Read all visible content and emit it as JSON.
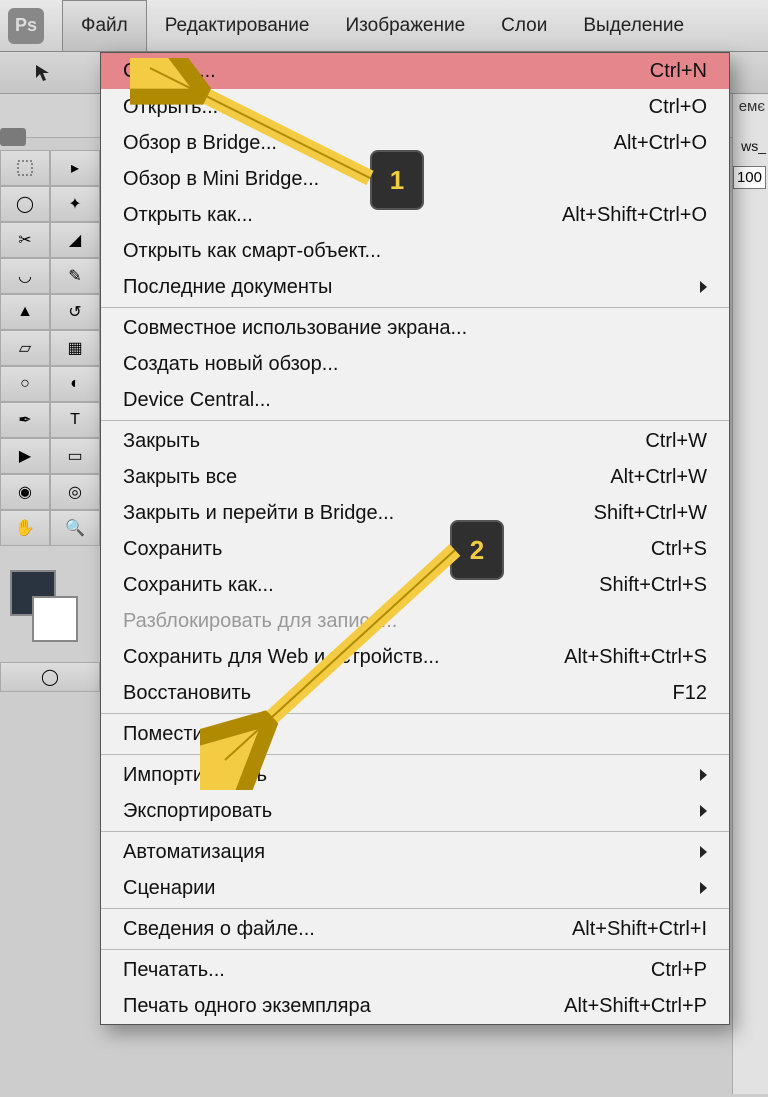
{
  "app_logo": "Ps",
  "menubar": {
    "items": [
      {
        "label": "Файл",
        "open": true
      },
      {
        "label": "Редактирование"
      },
      {
        "label": "Изображение"
      },
      {
        "label": "Слои"
      },
      {
        "label": "Выделение"
      }
    ]
  },
  "right": {
    "partial1": "емє",
    "partial2": "ws_",
    "value": "100"
  },
  "dropdown": {
    "items": [
      {
        "label": "Создать...",
        "shortcut": "Ctrl+N",
        "highlight": true
      },
      {
        "label": "Открыть...",
        "shortcut": "Ctrl+O"
      },
      {
        "label": "Обзор в Bridge...",
        "shortcut": "Alt+Ctrl+O"
      },
      {
        "label": "Обзор в Mini Bridge..."
      },
      {
        "label": "Открыть как...",
        "shortcut": "Alt+Shift+Ctrl+O"
      },
      {
        "label": "Открыть как смарт-объект..."
      },
      {
        "label": "Последние документы",
        "submenu": true
      },
      {
        "sep": true
      },
      {
        "label": "Совместное использование экрана..."
      },
      {
        "label": "Создать новый обзор..."
      },
      {
        "label": "Device Central..."
      },
      {
        "sep": true
      },
      {
        "label": "Закрыть",
        "shortcut": "Ctrl+W"
      },
      {
        "label": "Закрыть все",
        "shortcut": "Alt+Ctrl+W"
      },
      {
        "label": "Закрыть и перейти в Bridge...",
        "shortcut": "Shift+Ctrl+W"
      },
      {
        "label": "Сохранить",
        "shortcut": "Ctrl+S"
      },
      {
        "label": "Сохранить как...",
        "shortcut": "Shift+Ctrl+S"
      },
      {
        "label": "Разблокировать для записи...",
        "disabled": true
      },
      {
        "label": "Сохранить для Web и устройств...",
        "shortcut": "Alt+Shift+Ctrl+S"
      },
      {
        "label": "Восстановить",
        "shortcut": "F12"
      },
      {
        "sep": true
      },
      {
        "label": "Поместить..."
      },
      {
        "sep": true
      },
      {
        "label": "Импортировать",
        "submenu": true
      },
      {
        "label": "Экспортировать",
        "submenu": true
      },
      {
        "sep": true
      },
      {
        "label": "Автоматизация",
        "submenu": true
      },
      {
        "label": "Сценарии",
        "submenu": true
      },
      {
        "sep": true
      },
      {
        "label": "Сведения о файле...",
        "shortcut": "Alt+Shift+Ctrl+I"
      },
      {
        "sep": true
      },
      {
        "label": "Печатать...",
        "shortcut": "Ctrl+P"
      },
      {
        "label": "Печать одного экземпляра",
        "shortcut": "Alt+Shift+Ctrl+P"
      }
    ]
  },
  "badges": {
    "one": "1",
    "two": "2"
  }
}
